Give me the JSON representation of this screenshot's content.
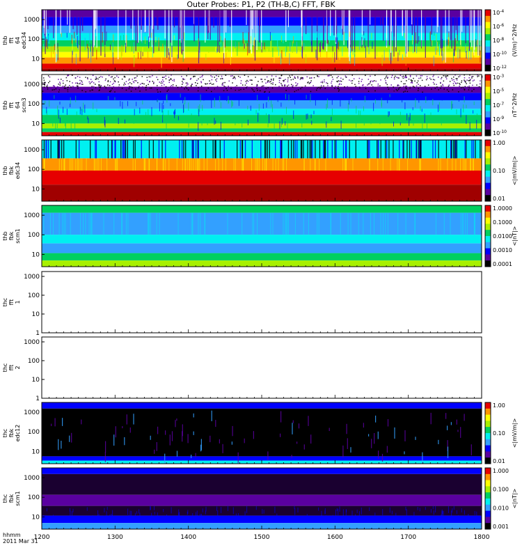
{
  "title": "Outer Probes: P1, P2 (TH-B,C) FFT, FBK",
  "time_axis": {
    "row1_label": "hhmm",
    "row2_label": "2011 Mar 31",
    "ticks": [
      "1200",
      "1300",
      "1400",
      "1500",
      "1600",
      "1700",
      "1800"
    ],
    "range": [
      1200,
      1800
    ]
  },
  "palette": {
    "black": "#000000",
    "purple": "#5a00a0",
    "blue": "#0000ff",
    "sky": "#33a0ff",
    "cyan": "#00f0f0",
    "green": "#00d060",
    "lime": "#a8f000",
    "yellow": "#ffff00",
    "orange": "#ff9600",
    "red": "#e60000",
    "darkred": "#a00000"
  },
  "chart_data": [
    {
      "type": "heatmap",
      "id": "thb-fft-edc34",
      "ylabel": [
        "thb",
        "fft",
        "64",
        "edc34"
      ],
      "yticks": [
        "1000",
        "100",
        "10"
      ],
      "colorbar_ticks": [
        "10^-4",
        "10^-6",
        "10^-8",
        "10^-10",
        "10^-12"
      ],
      "colorbar_label": "(V/m)^2/Hz",
      "style": "spectral"
    },
    {
      "type": "heatmap",
      "id": "thb-fft-scm3",
      "ylabel": [
        "thb",
        "fft",
        "64",
        "scm3"
      ],
      "yticks": [
        "1000",
        "100",
        "10"
      ],
      "colorbar_ticks": [
        "10^-3",
        "10^-5",
        "10^-7",
        "10^-9",
        "10^-10"
      ],
      "colorbar_label": "nT^2/Hz",
      "style": "scm_spectral"
    },
    {
      "type": "heatmap",
      "id": "thb-fbk-edc34",
      "ylabel": [
        "thb",
        "fbk",
        "edc34"
      ],
      "yticks": [
        "1000",
        "100",
        "10"
      ],
      "colorbar_ticks": [
        "1.00",
        "0.10",
        "0.01"
      ],
      "colorbar_label": "<|mV/m|>",
      "style": "fbk_e"
    },
    {
      "type": "heatmap",
      "id": "thb-fbk-scm1",
      "ylabel": [
        "thb",
        "fbk",
        "scm1"
      ],
      "yticks": [
        "1000",
        "100",
        "10"
      ],
      "colorbar_ticks": [
        "1.0000",
        "0.1000",
        "0.0100",
        "0.0010",
        "0.0001"
      ],
      "colorbar_label": "<|nT|>",
      "style": "fbk_b"
    },
    {
      "type": "heatmap",
      "id": "thc-fft-1",
      "ylabel": [
        "thc",
        "fft",
        "1"
      ],
      "yticks": [
        "1000",
        "100",
        "10",
        "1"
      ],
      "colorbar_ticks": [],
      "colorbar_label": "",
      "style": "empty"
    },
    {
      "type": "heatmap",
      "id": "thc-fft-2",
      "ylabel": [
        "thc",
        "fft",
        "2"
      ],
      "yticks": [
        "1000",
        "100",
        "10",
        "1"
      ],
      "colorbar_ticks": [],
      "colorbar_label": "",
      "style": "empty"
    },
    {
      "type": "heatmap",
      "id": "thc-fbk-edc12",
      "ylabel": [
        "thc",
        "fbk",
        "edc12"
      ],
      "yticks": [
        "1000",
        "100",
        "10"
      ],
      "colorbar_ticks": [
        "1.00",
        "0.10",
        "0.01"
      ],
      "colorbar_label": "<|mV/m|>",
      "style": "thc_e"
    },
    {
      "type": "heatmap",
      "id": "thc-fbk-scm1",
      "ylabel": [
        "thc",
        "fbk",
        "scm1"
      ],
      "yticks": [
        "1000",
        "100",
        "10"
      ],
      "colorbar_ticks": [
        "1.000",
        "0.100",
        "0.010",
        "0.001"
      ],
      "colorbar_label": "<|nT|>",
      "style": "thc_b"
    }
  ]
}
